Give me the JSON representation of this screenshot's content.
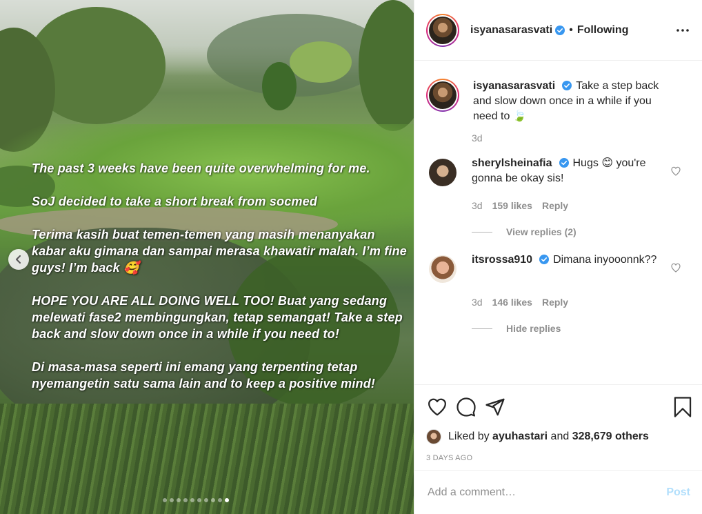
{
  "story": {
    "lines": [
      "The past 3 weeks have been quite overwhelming for me.",
      "SoJ decided to take a short break from socmed",
      "Terima kasih buat temen-temen yang masih menanyakan kabar aku gimana dan sampai merasa khawatir malah. I’m fine guys! I’m back 🥰",
      "HOPE YOU ARE ALL DOING WELL TOO! Buat yang sedang melewati fase2 membingungkan, tetap semangat! Take a step back and slow down once in a while if you need to!",
      "Di masa-masa seperti ini emang yang terpenting tetap nyemangetin satu sama lain and to keep a positive mind!"
    ],
    "slide_count": 10,
    "active_slide": 10
  },
  "header": {
    "username": "isyanasarasvati",
    "separator": "•",
    "follow_label": "Following"
  },
  "caption": {
    "username": "isyanasarasvati",
    "text": "Take a step back and slow down once in a while if you need to",
    "emoji": "🍃",
    "age": "3d"
  },
  "comments": [
    {
      "username": "sherylsheinafia",
      "text_before": "Hugs",
      "emoji": "😊",
      "text_after": "you're gonna be okay sis!",
      "age": "3d",
      "likes": "159 likes",
      "reply_label": "Reply",
      "replies_label": "View replies (2)"
    },
    {
      "username": "itsrossa910",
      "text": "Dimana inyooonnk??",
      "age": "3d",
      "likes": "146 likes",
      "reply_label": "Reply",
      "replies_label": "Hide replies"
    }
  ],
  "likes": {
    "prefix": "Liked by",
    "user": "ayuhastari",
    "middle": "and",
    "others": "328,679 others"
  },
  "time_ago": "3 DAYS AGO",
  "add_comment": {
    "placeholder": "Add a comment…",
    "post_label": "Post"
  },
  "colors": {
    "verified": "#3897f0",
    "post_button": "#b2dffc",
    "meta_text": "#8e8e8e"
  }
}
